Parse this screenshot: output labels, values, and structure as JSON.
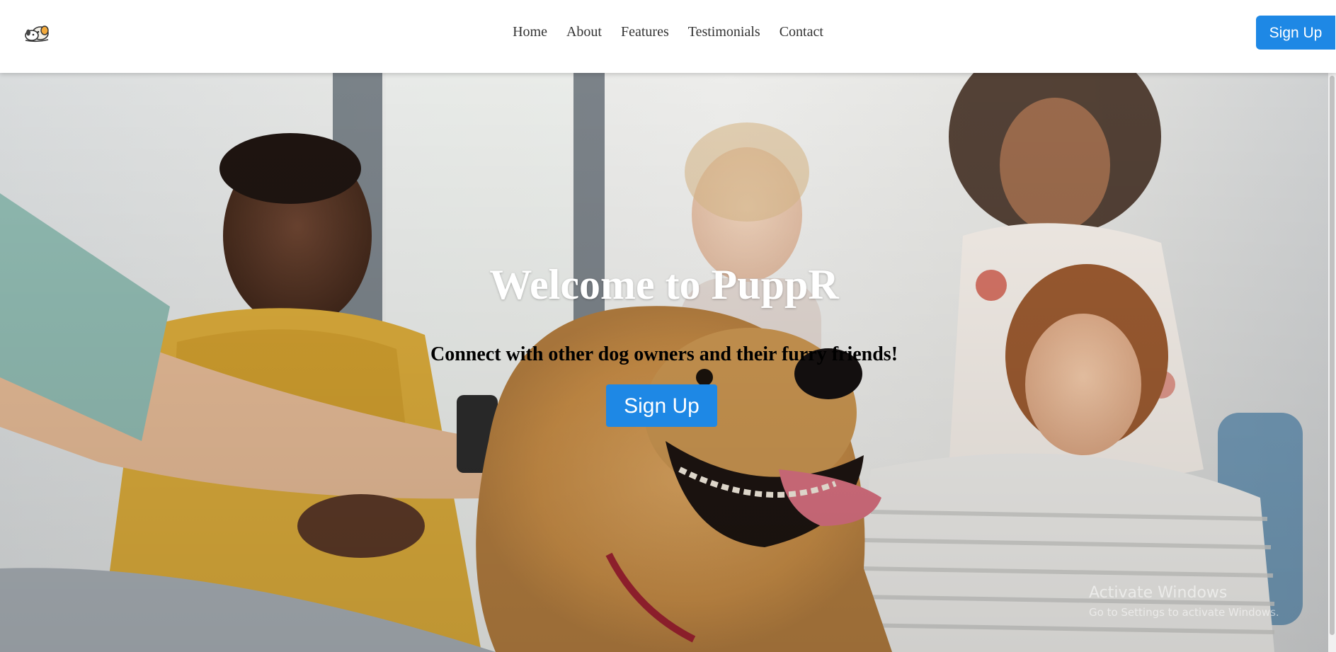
{
  "brand": {
    "logo_icon": "dog-logo-icon"
  },
  "nav": {
    "items": [
      {
        "label": "Home"
      },
      {
        "label": "About"
      },
      {
        "label": "Features"
      },
      {
        "label": "Testimonials"
      },
      {
        "label": "Contact"
      }
    ],
    "signup_label": "Sign Up"
  },
  "hero": {
    "title": "Welcome to PuppR",
    "subtitle": "Connect with other dog owners and their furry friends!",
    "cta_label": "Sign Up"
  },
  "watermark": {
    "title": "Activate Windows",
    "subtitle": "Go to Settings to activate Windows."
  },
  "colors": {
    "accent": "#1e88e5",
    "header_bg": "#ffffff",
    "nav_text": "#333333",
    "hero_title": "#ffffff",
    "hero_subtitle": "#000000"
  }
}
